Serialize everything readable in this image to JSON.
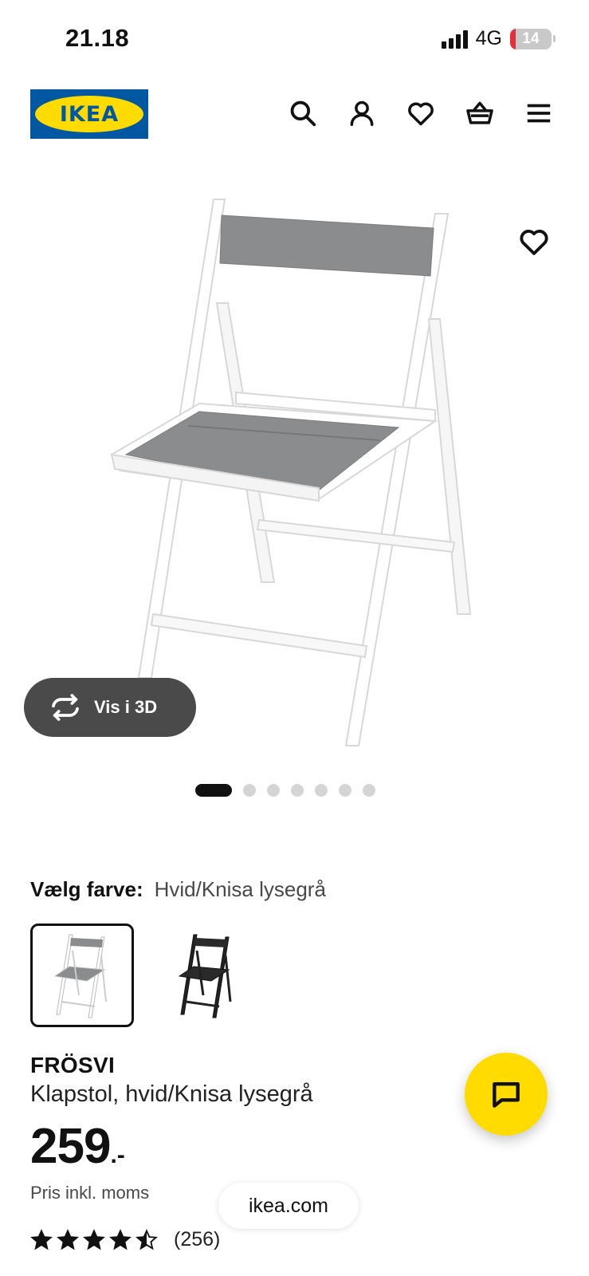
{
  "status_bar": {
    "time": "21.18",
    "network": "4G",
    "battery": "14",
    "battery_level": 0.14
  },
  "header": {
    "logo_text": "IKEA",
    "icons": [
      "search-icon",
      "account-icon",
      "heart-icon",
      "basket-icon",
      "menu-icon"
    ]
  },
  "product_image": {
    "view_3d_label": "Vis i 3D",
    "carousel_total": 7,
    "carousel_active": 1
  },
  "color": {
    "label": "Vælg farve:",
    "value": "Hvid/Knisa lysegrå",
    "options": [
      "white-chair",
      "black-chair"
    ],
    "selected_index": 0
  },
  "product": {
    "name": "FRÖSVI",
    "description": "Klapstol, hvid/Knisa lysegrå",
    "price_int": "259",
    "price_suffix": ".-",
    "price_note": "Pris inkl. moms",
    "rating": 4.5,
    "review_count": "(256)"
  },
  "browser": {
    "url": "ikea.com"
  },
  "colors": {
    "brand_blue": "#0058a3",
    "brand_yellow": "#ffdb00",
    "button_dark": "#4a4a4a",
    "battery_red": "#e5303b"
  }
}
